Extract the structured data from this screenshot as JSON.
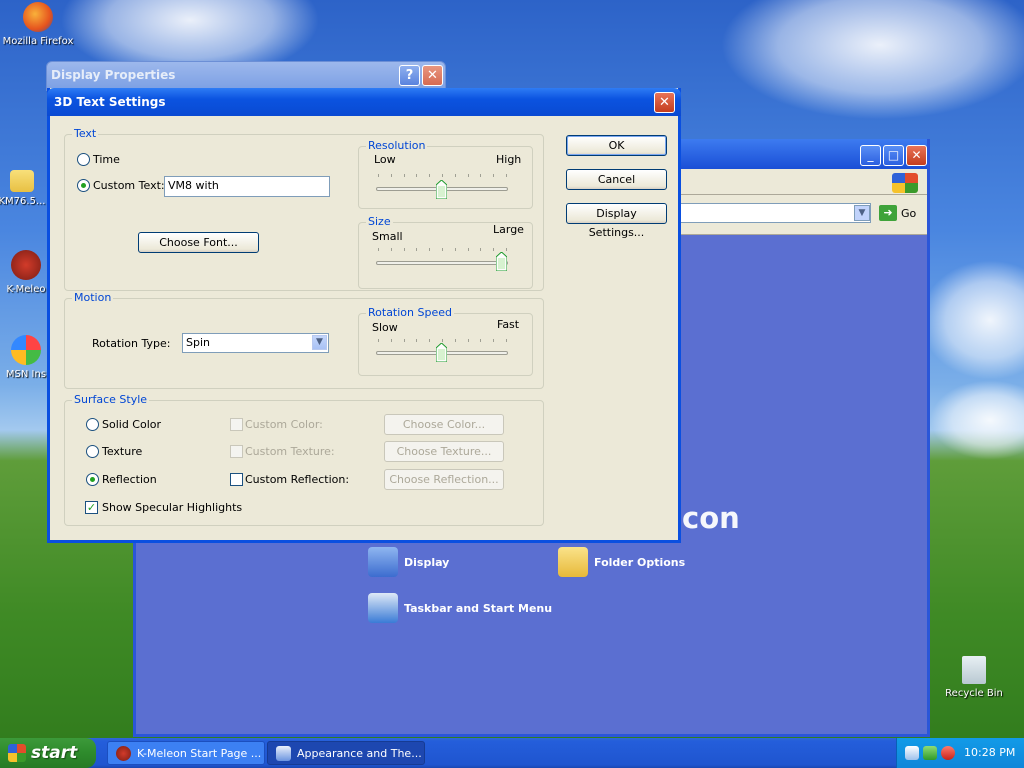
{
  "desktop": {
    "icons": [
      {
        "label": "Mozilla Firefox"
      },
      {
        "label": "KM76.5..."
      },
      {
        "label": "K-Meleo"
      },
      {
        "label": "MSN Ins"
      },
      {
        "label": "Recycle Bin"
      }
    ]
  },
  "background_window": {
    "go_label": "Go",
    "heading_fragment": "con",
    "tiles": [
      {
        "label": "Display"
      },
      {
        "label": "Folder Options"
      },
      {
        "label": "Taskbar and Start Menu"
      }
    ]
  },
  "display_properties": {
    "title": "Display Properties",
    "help_label": "?",
    "close_label": "✕"
  },
  "dialog": {
    "title": "3D Text Settings",
    "close_label": "✕",
    "text_group": {
      "label": "Text",
      "time_label": "Time",
      "custom_text_label": "Custom Text:",
      "custom_text_value": "VM8 with",
      "choose_font_label": "Choose Font..."
    },
    "resolution": {
      "label": "Resolution",
      "low": "Low",
      "high": "High",
      "value": 0.5
    },
    "size": {
      "label": "Size",
      "small": "Small",
      "large": "Large",
      "value": 1.0
    },
    "motion": {
      "label": "Motion",
      "rotation_type_label": "Rotation Type:",
      "rotation_type_value": "Spin"
    },
    "rotation_speed": {
      "label": "Rotation Speed",
      "slow": "Slow",
      "fast": "Fast",
      "value": 0.5
    },
    "surface": {
      "label": "Surface Style",
      "solid_color": "Solid Color",
      "texture": "Texture",
      "reflection": "Reflection",
      "custom_color": "Custom Color:",
      "custom_texture": "Custom Texture:",
      "custom_reflection": "Custom Reflection:",
      "choose_color": "Choose Color...",
      "choose_texture": "Choose Texture...",
      "choose_reflection": "Choose Reflection...",
      "show_specular": "Show Specular Highlights"
    },
    "buttons": {
      "ok": "OK",
      "cancel": "Cancel",
      "display_settings": "Display Settings..."
    }
  },
  "taskbar": {
    "start_label": "start",
    "tasks": [
      {
        "label": "K-Meleon Start Page ..."
      },
      {
        "label": "Appearance and The..."
      }
    ],
    "clock": "10:28 PM"
  }
}
